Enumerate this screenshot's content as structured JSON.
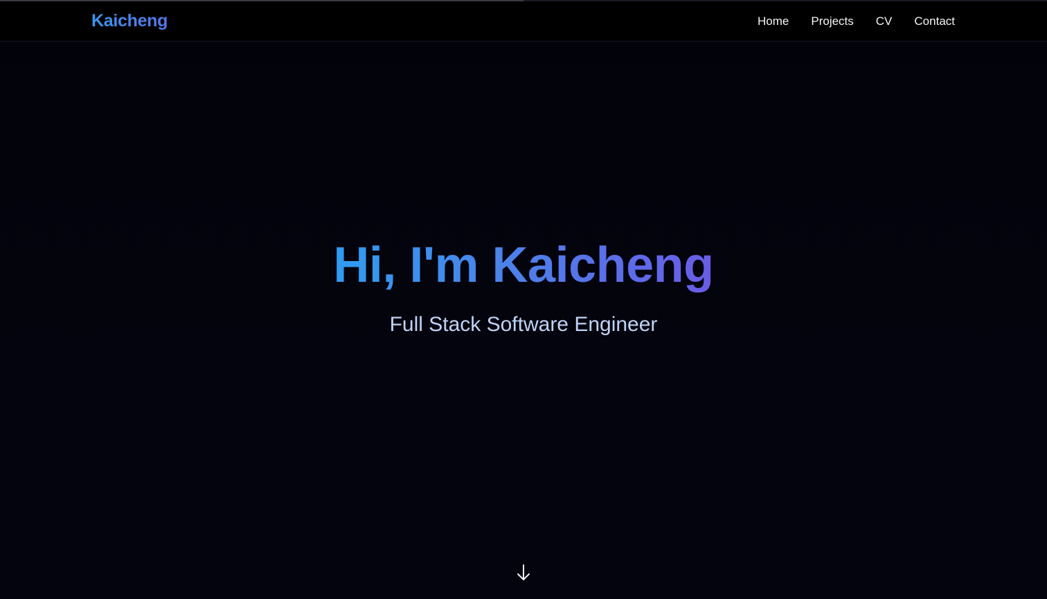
{
  "header": {
    "logo_text": "Kaicheng",
    "nav": [
      {
        "label": "Home"
      },
      {
        "label": "Projects"
      },
      {
        "label": "CV"
      },
      {
        "label": "Contact"
      }
    ]
  },
  "scroll_progress": 0.5,
  "hero": {
    "title": "Hi, I'm Kaicheng",
    "subtitle": "Full Stack Software Engineer",
    "scroll_icon": "arrow-down-icon"
  },
  "colors": {
    "background": "#03030c",
    "accent_start": "#2f9cf0",
    "accent_end": "#6a5ce6",
    "subtitle": "#bfd4f5",
    "nav_text": "#f4f5f8"
  }
}
